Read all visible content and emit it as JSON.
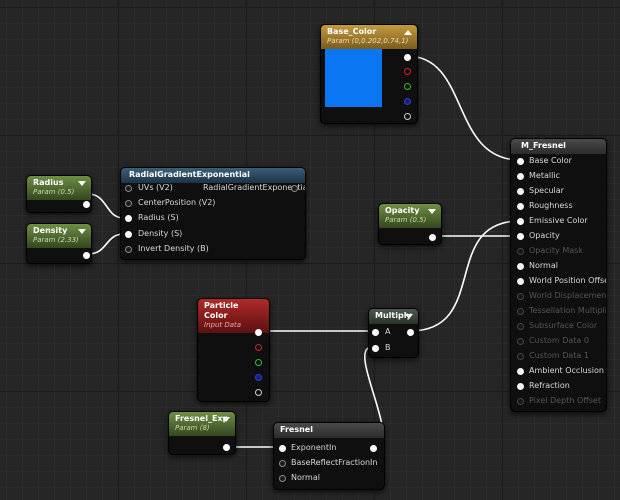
{
  "nodes": {
    "base_color": {
      "title": "Base_Color",
      "subtitle": "Param (0,0.202,0.74,1)",
      "swatch_color": "#0a76f2"
    },
    "radial": {
      "title": "RadialGradientExponential",
      "inputs": [
        "UVs (V2)",
        "CenterPosition (V2)",
        "Radius (S)",
        "Density (S)",
        "Invert Density (B)"
      ],
      "output": "RadialGradientExponential"
    },
    "radius": {
      "title": "Radius",
      "subtitle": "Param (0.5)"
    },
    "density": {
      "title": "Density",
      "subtitle": "Param (2.33)"
    },
    "opacity": {
      "title": "Opacity",
      "subtitle": "Param (0.5)"
    },
    "particle_color": {
      "title": "Particle Color",
      "subtitle": "Input Data"
    },
    "multiply": {
      "title": "Multiply",
      "inputs": [
        "A",
        "B"
      ]
    },
    "fresnel_exp": {
      "title": "Fresnel_Exp",
      "subtitle": "Param (8)"
    },
    "fresnel": {
      "title": "Fresnel",
      "inputs": [
        "ExponentIn",
        "BaseReflectFractionIn",
        "Normal"
      ]
    },
    "material": {
      "title": "M_Fresnel",
      "inputs": [
        {
          "label": "Base Color",
          "enabled": true,
          "connected": true
        },
        {
          "label": "Metallic",
          "enabled": true,
          "connected": false
        },
        {
          "label": "Specular",
          "enabled": true,
          "connected": false
        },
        {
          "label": "Roughness",
          "enabled": true,
          "connected": false
        },
        {
          "label": "Emissive Color",
          "enabled": true,
          "connected": true
        },
        {
          "label": "Opacity",
          "enabled": true,
          "connected": true
        },
        {
          "label": "Opacity Mask",
          "enabled": false,
          "connected": false
        },
        {
          "label": "Normal",
          "enabled": true,
          "connected": false
        },
        {
          "label": "World Position Offset",
          "enabled": true,
          "connected": false
        },
        {
          "label": "World Displacement",
          "enabled": false,
          "connected": false
        },
        {
          "label": "Tessellation Multiplier",
          "enabled": false,
          "connected": false
        },
        {
          "label": "Subsurface Color",
          "enabled": false,
          "connected": false
        },
        {
          "label": "Custom Data 0",
          "enabled": false,
          "connected": false
        },
        {
          "label": "Custom Data 1",
          "enabled": false,
          "connected": false
        },
        {
          "label": "Ambient Occlusion",
          "enabled": true,
          "connected": false
        },
        {
          "label": "Refraction",
          "enabled": true,
          "connected": false
        },
        {
          "label": "Pixel Depth Offset",
          "enabled": false,
          "connected": false
        }
      ]
    }
  }
}
